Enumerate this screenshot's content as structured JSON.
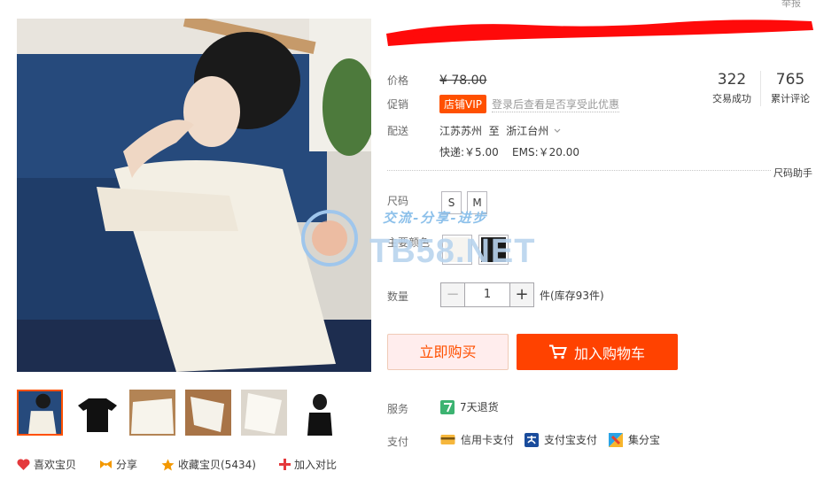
{
  "top": {
    "report": "举报"
  },
  "price": {
    "label": "价格",
    "currency": "¥",
    "value": "78.00",
    "text": "¥ 78.00"
  },
  "stats": {
    "sold_count": "322",
    "sold_label": "交易成功",
    "review_count": "765",
    "review_label": "累计评论"
  },
  "promo": {
    "label": "促销",
    "badge": "店铺VIP",
    "hint": "登录后查看是否享受此优惠"
  },
  "shipping": {
    "label": "配送",
    "route": "江苏苏州  至  浙江台州",
    "fees": "快递:￥5.00    EMS:￥20.00"
  },
  "size_helper": "尺码助手",
  "options": {
    "size_label": "尺码",
    "sizes": [
      "S",
      "M"
    ],
    "color_label": "主要颜色",
    "colors": [
      {
        "name": "white",
        "hex": "#f6f4f0"
      },
      {
        "name": "black",
        "hex": "#1a1a1a"
      }
    ]
  },
  "watermark": {
    "text": "交流-分享-进步",
    "logo": "TB58.NET"
  },
  "quantity": {
    "label": "数量",
    "value": "1",
    "minus": "−",
    "plus": "+",
    "stock": "件(库存93件)"
  },
  "actions": {
    "buy_now": "立即购买",
    "add_to_cart": "加入购物车"
  },
  "service": {
    "label": "服务",
    "items": [
      {
        "icon": "seven-day-return-icon",
        "text": "7天退货"
      }
    ]
  },
  "payment": {
    "label": "支付",
    "methods": [
      {
        "icon": "credit-card-icon",
        "text": "信用卡支付"
      },
      {
        "icon": "alipay-icon",
        "text": "支付宝支付"
      },
      {
        "icon": "jifenbao-icon",
        "text": "集分宝"
      }
    ]
  },
  "social": {
    "like": "喜欢宝贝",
    "share": "分享",
    "favorite": "收藏宝贝(5434)",
    "compare": "加入对比"
  },
  "colors": {
    "accent": "#ff5000",
    "cart_button": "#ff4200",
    "buy_button_bg": "#ffeded"
  }
}
